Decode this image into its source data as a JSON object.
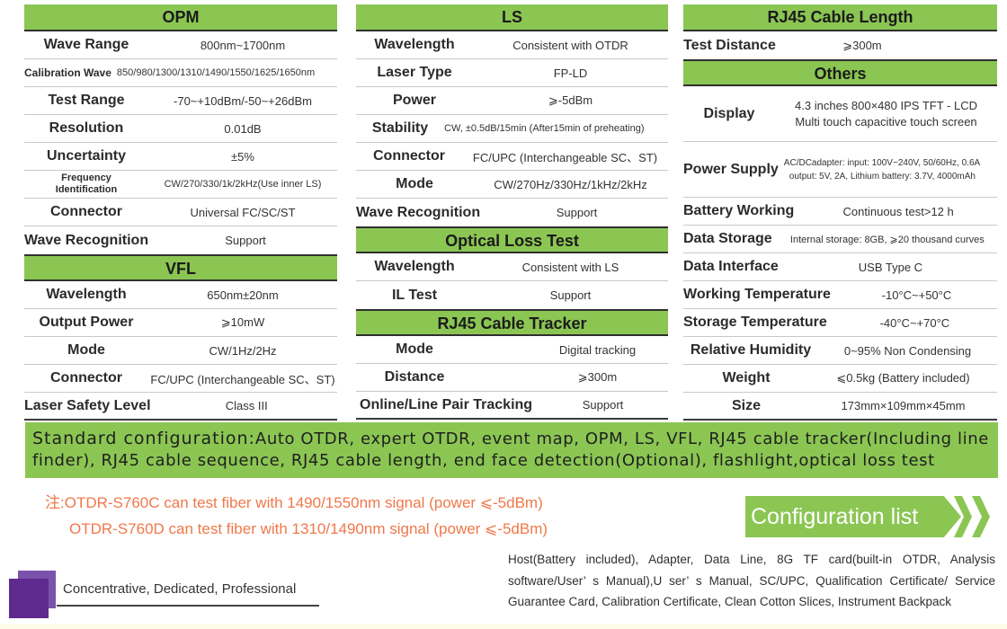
{
  "opm": {
    "title": "OPM",
    "rows": [
      {
        "k": "Wave Range",
        "v": "800nm~1700nm"
      },
      {
        "k": "Calibration Wave",
        "v": "850/980/1300/1310/1490/1550/1625/1650nm"
      },
      {
        "k": "Test Range",
        "v": "-70~+10dBm/-50~+26dBm"
      },
      {
        "k": "Resolution",
        "v": "0.01dB"
      },
      {
        "k": "Uncertainty",
        "v": "±5%"
      },
      {
        "k": "Frequency Identification",
        "v": "CW/270/330/1k/2kHz(Use inner LS)"
      },
      {
        "k": "Connector",
        "v": "Universal FC/SC/ST"
      },
      {
        "k": "Wave Recognition",
        "v": "Support"
      }
    ]
  },
  "vfl": {
    "title": "VFL",
    "rows": [
      {
        "k": "Wavelength",
        "v": "650nm±20nm"
      },
      {
        "k": "Output Power",
        "v": "⩾10mW"
      },
      {
        "k": "Mode",
        "v": "CW/1Hz/2Hz"
      },
      {
        "k": "Connector",
        "v": "FC/UPC (Interchangeable SC、ST)"
      },
      {
        "k": "Laser Safety Level",
        "v": "Class III"
      }
    ]
  },
  "ls": {
    "title": "LS",
    "rows": [
      {
        "k": "Wavelength",
        "v": "Consistent with OTDR"
      },
      {
        "k": "Laser Type",
        "v": "FP-LD"
      },
      {
        "k": "Power",
        "v": "⩾-5dBm"
      },
      {
        "k": "Stability",
        "v": "CW, ±0.5dB/15min (After15min of preheating)"
      },
      {
        "k": "Connector",
        "v": "FC/UPC (Interchangeable SC、ST)"
      },
      {
        "k": "Mode",
        "v": "CW/270Hz/330Hz/1kHz/2kHz"
      },
      {
        "k": "Wave Recognition",
        "v": "Support"
      }
    ]
  },
  "olt": {
    "title": "Optical Loss Test",
    "rows": [
      {
        "k": "Wavelength",
        "v": "Consistent with LS"
      },
      {
        "k": "IL Test",
        "v": "Support"
      }
    ]
  },
  "tracker": {
    "title": "RJ45 Cable Tracker",
    "rows": [
      {
        "k": "Mode",
        "v": "Digital tracking"
      },
      {
        "k": "Distance",
        "v": "⩾300m"
      },
      {
        "k": "Online/Line Pair Tracking",
        "v": "Support"
      }
    ]
  },
  "length": {
    "title": "RJ45 Cable Length",
    "rows": [
      {
        "k": "Test Distance",
        "v": "⩾300m"
      }
    ]
  },
  "others": {
    "title": "Others",
    "display": {
      "k": "Display",
      "v1": "4.3 inches 800×480  IPS  TFT - LCD",
      "v2": "Multi touch capacitive touch screen"
    },
    "power": {
      "k": "Power Supply",
      "v1": "AC/DCadapter: input: 100V~240V, 50/60Hz, 0.6A",
      "v2": "output: 5V, 2A, Lithium battery: 3.7V, 4000mAh"
    },
    "rows": [
      {
        "k": "Battery Working",
        "v": "Continuous test>12 h"
      },
      {
        "k": "Data Storage",
        "v": "Internal storage: 8GB, ⩾20 thousand curves"
      },
      {
        "k": "Data Interface",
        "v": "USB Type C"
      },
      {
        "k": "Working Temperature",
        "v": "-10°C~+50°C"
      },
      {
        "k": "Storage Temperature",
        "v": "-40°C~+70°C"
      },
      {
        "k": "Relative Humidity",
        "v": "0~95% Non Condensing"
      },
      {
        "k": "Weight",
        "v": "⩽0.5kg (Battery included)"
      },
      {
        "k": "Size",
        "v": "173mm×109mm×45mm"
      }
    ]
  },
  "standard_config": {
    "label": "Standard configuration:",
    "text": "Auto OTDR, expert OTDR, event map, OPM, LS, VFL, RJ45 cable tracker(Including line finder), RJ45 cable sequence, RJ45 cable length, end face detection(Optional), flashlight,optical loss test"
  },
  "note": {
    "line1": "注:OTDR-S760C can test fiber with 1490/1550nm signal (power ⩽-5dBm)",
    "line2": "OTDR-S760D can test fiber with 1310/1490nm signal (power ⩽-5dBm)"
  },
  "config_list": {
    "title": "Configuration list",
    "text": "Host(Battery included), Adapter, Data Line, 8G TF card(built-in OTDR, Analysis software/User’ s Manual),U ser’ s Manual, SC/UPC, Qualification Certificate/ Service Guarantee Card, Calibration Certificate, Clean Cotton Slices, Instrument Backpack"
  },
  "brand": {
    "tagline": "Concentrative, Dedicated, Professional"
  },
  "colors": {
    "accent_green": "#8bc653",
    "note_orange": "#f0784a",
    "brand_purple": "#5e2a8e"
  }
}
